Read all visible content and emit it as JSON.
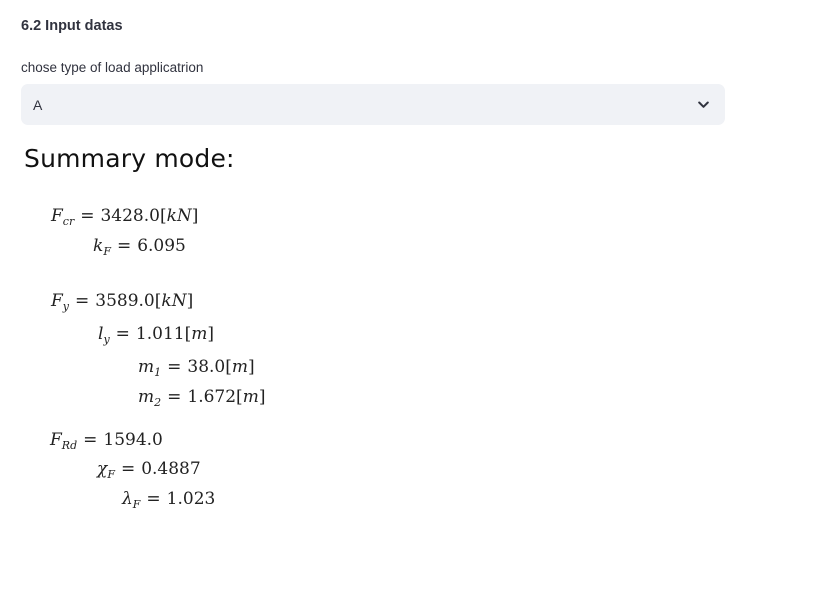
{
  "section": {
    "title": "6.2 Input datas"
  },
  "select": {
    "label": "chose type of load applicatrion",
    "value": "A",
    "chevron_icon": "chevron-down-icon"
  },
  "summary": {
    "title": "Summary mode:",
    "rows": [
      {
        "symbol": "F",
        "sub": "cr",
        "value": "3428.0",
        "unit": "kN"
      },
      {
        "symbol": "k",
        "sub": "F",
        "value": "6.095",
        "unit": ""
      },
      {
        "symbol": "F",
        "sub": "y",
        "value": "3589.0",
        "unit": "kN"
      },
      {
        "symbol": "l",
        "sub": "y",
        "value": "1.011",
        "unit": "m"
      },
      {
        "symbol": "m",
        "sub": "1",
        "value": "38.0",
        "unit": "m"
      },
      {
        "symbol": "m",
        "sub": "2",
        "value": "1.672",
        "unit": "m"
      },
      {
        "symbol": "F",
        "sub": "Rd",
        "value": "1594.0",
        "unit": ""
      },
      {
        "symbol": "χ",
        "sub": "F",
        "value": "0.4887",
        "unit": ""
      },
      {
        "symbol": "λ",
        "sub": "F",
        "value": "1.023",
        "unit": ""
      }
    ]
  }
}
